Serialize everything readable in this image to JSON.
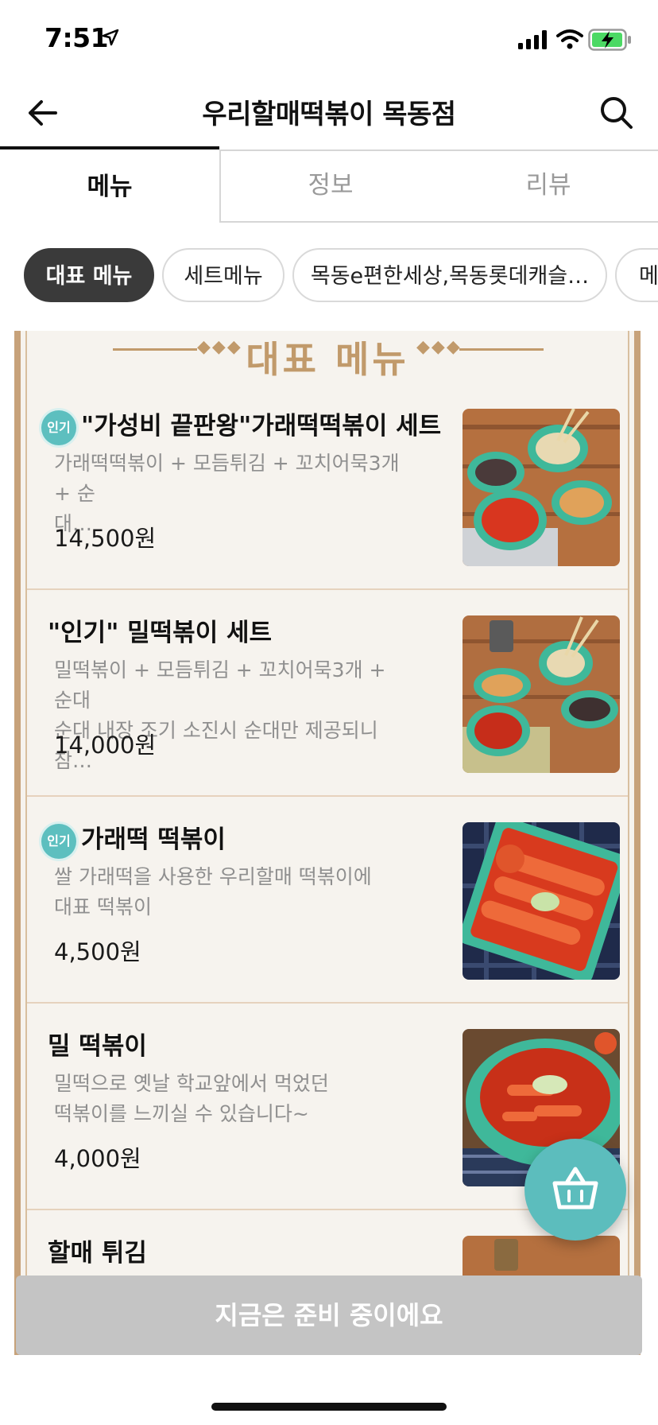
{
  "status_bar": {
    "time": "7:51"
  },
  "header": {
    "title": "우리할매떡볶이 목동점"
  },
  "tabs": [
    {
      "label": "메뉴",
      "active": true
    },
    {
      "label": "정보",
      "active": false
    },
    {
      "label": "리뷰",
      "active": false
    }
  ],
  "chips": [
    {
      "label": "대표 메뉴",
      "active": true
    },
    {
      "label": "세트메뉴",
      "active": false
    },
    {
      "label": "목동e편한세상,목동롯데캐슬…",
      "active": false
    },
    {
      "label": "메",
      "active": false
    }
  ],
  "board": {
    "title": "대표 메뉴"
  },
  "menu_items": [
    {
      "badge": "인기",
      "name": "\"가성비 끝판왕\"가래떡떡볶이 세트",
      "description": "가래떡떡볶이 + 모듬튀김 + 꼬치어묵3개 + 순\n대…",
      "price": "14,500원"
    },
    {
      "badge": "",
      "name": "\"인기\" 밀떡볶이 세트",
      "description": "밀떡볶이 + 모듬튀김 + 꼬치어묵3개 + 순대\n순대 내장 조기 소진시 순대만 제공되니 참…",
      "price": "14,000원"
    },
    {
      "badge": "인기",
      "name": "가래떡 떡볶이",
      "description": "쌀 가래떡을 사용한 우리할매 떡볶이에\n대표 떡볶이",
      "price": "4,500원"
    },
    {
      "badge": "",
      "name": "밀 떡볶이",
      "description": "밀떡으로 옛날 학교앞에서 먹었던\n떡볶이를 느끼실 수 있습니다~",
      "price": "4,000원"
    },
    {
      "badge": "",
      "name": "할매 튀김",
      "description": "",
      "price": ""
    }
  ],
  "bottom_cta": {
    "label": "지금은 준비 중이에요"
  },
  "colors": {
    "accent": "#5cbdbd",
    "board_border": "#c7a27a",
    "board_title": "#c19a6b",
    "cta_disabled": "#c4c4c4"
  },
  "icons": {
    "back": "back-arrow-icon",
    "search": "search-icon",
    "cart": "shopping-basket-icon"
  }
}
